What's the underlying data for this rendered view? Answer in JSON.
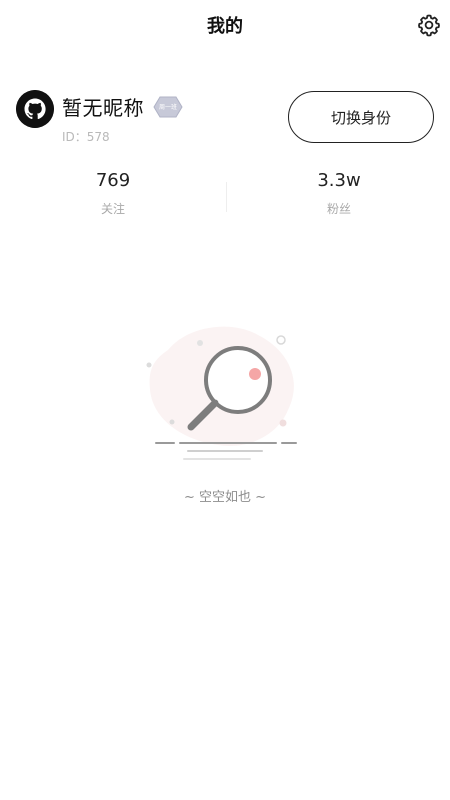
{
  "header": {
    "title": "我的",
    "settings_icon": "gear-icon"
  },
  "profile": {
    "avatar_icon": "github-octocat-icon",
    "nickname": "暂无昵称",
    "badge_text": "周一班",
    "id_text": "ID：578",
    "switch_label": "切换身份"
  },
  "stats": [
    {
      "value": "769",
      "label": "关注"
    },
    {
      "value": "3.3w",
      "label": "粉丝"
    }
  ],
  "empty": {
    "illustration_icon": "magnifier-empty-icon",
    "text": "~ 空空如也 ~"
  },
  "colors": {
    "background": "#ffffff",
    "text_primary": "#222222",
    "text_secondary": "#a9a9a9",
    "accent_dot": "#f5a6a6"
  }
}
